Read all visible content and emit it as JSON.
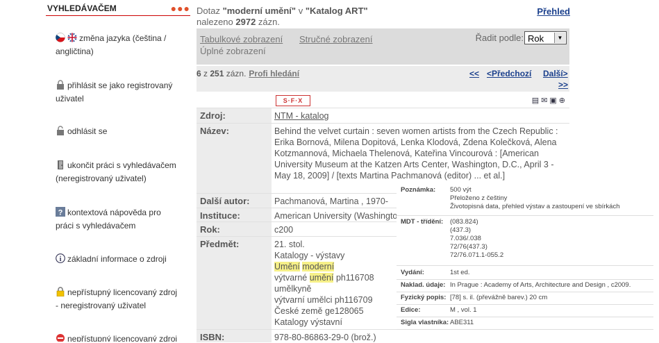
{
  "sidebar": {
    "title": "VYHLEDÁVAČEM",
    "items": [
      {
        "label": "změna jazyka (čeština / angličtina)"
      },
      {
        "label": "přihlásit se jako registrovaný uživatel"
      },
      {
        "label": "odhlásit se"
      },
      {
        "label": "ukončit práci s vyhledávačem (neregistrovaný uživatel)"
      },
      {
        "label": "kontextová nápověda pro práci s vyhledávačem"
      },
      {
        "label": "základní informace o zdroji"
      },
      {
        "label": "nepřístupný licencovaný zdroj - neregistrovaný uživatel"
      },
      {
        "label": "nepřístupný licencovaný zdroj"
      }
    ]
  },
  "query": {
    "prefix": "Dotaz ",
    "term": "\"moderní umění\"",
    "mid": " v ",
    "catalog": "\"Katalog ART\"",
    "found_prefix": "nalezeno ",
    "count": "2972",
    "found_suffix": " zázn."
  },
  "overview_link": "Přehled",
  "views": {
    "table": "Tabulkové zobrazení",
    "brief": "Stručné zobrazení",
    "full": "Úplné zobrazení"
  },
  "sort": {
    "label": "Řadit podle:",
    "value": "Rok"
  },
  "pager": {
    "current": "6",
    "of": " z ",
    "total": "251",
    "suffix": " zázn.",
    "profi": "Profi hledání",
    "first": "<<",
    "prev": "<Předchozí",
    "next": "Další>",
    "last": ">>"
  },
  "sfx_label": "S·F·X",
  "record": {
    "zdroj": {
      "label": "Zdroj:",
      "value": "NTM - katalog"
    },
    "nazev": {
      "label": "Název:",
      "value": "Behind the velvet curtain : seven women artists from the Czech Republic : Erika Bornová, Milena Dopitová, Lenka Klodová, Zdena Kolečková, Alena Kotzmannová, Michaela Thelenová, Kateřina Vincourová : [American University Museum at the Katzen Arts Center, Washington, D.C., April 3 - May 18, 2009]  / [texts Martina Pachmanová (editor) ... et al.]"
    },
    "autor": {
      "label": "Další autor:",
      "value": "Pachmanová, Martina , 1970-"
    },
    "instituce": {
      "label": "Instituce:",
      "value": "American University (Washington"
    },
    "rok": {
      "label": "Rok:",
      "value": "c200"
    },
    "predmet": {
      "label": "Předmět:",
      "l1": "21. stol.",
      "l2": "Katalogy - výstavy",
      "l3a": "Umění",
      "l3b": "moderní",
      "l4a": "výtvarné ",
      "l4b": "umění",
      "l4c": " ph116708",
      "l5": "umělkyně",
      "l6": "výtvarní umělci ph116709",
      "l7": "České země ge128065",
      "l8": "Katalogy výstavní"
    },
    "isbn": {
      "label": "ISBN:",
      "value": "978-80-86863-29-0 (brož.)"
    }
  },
  "tooltip": {
    "poznamka": {
      "label": "Poznámka:",
      "lines": [
        "500 výt",
        "Přeloženo z češtiny",
        "Životopisná data, přehled výstav a zastoupení ve sbírkách"
      ]
    },
    "mdt": {
      "label": "MDT - třídění:",
      "lines": [
        "(083.824)",
        "(437.3)",
        "7.036/.038",
        "72/76(437.3)",
        "72/76.071.1-055.2"
      ]
    },
    "vydani": {
      "label": "Vydání:",
      "value": "1st ed."
    },
    "naklad": {
      "label": "Naklad. údaje:",
      "value": "In Prague : Academy of Arts, Architecture and Design , c2009."
    },
    "fyzicky": {
      "label": "Fyzický popis:",
      "value": "[78] s. il. (převážně barev.)  20 cm"
    },
    "edice": {
      "label": "Edice:",
      "value": "M , vol. 1"
    },
    "sigla": {
      "label": "Sigla vlastníka:",
      "value": "ABE311"
    }
  }
}
